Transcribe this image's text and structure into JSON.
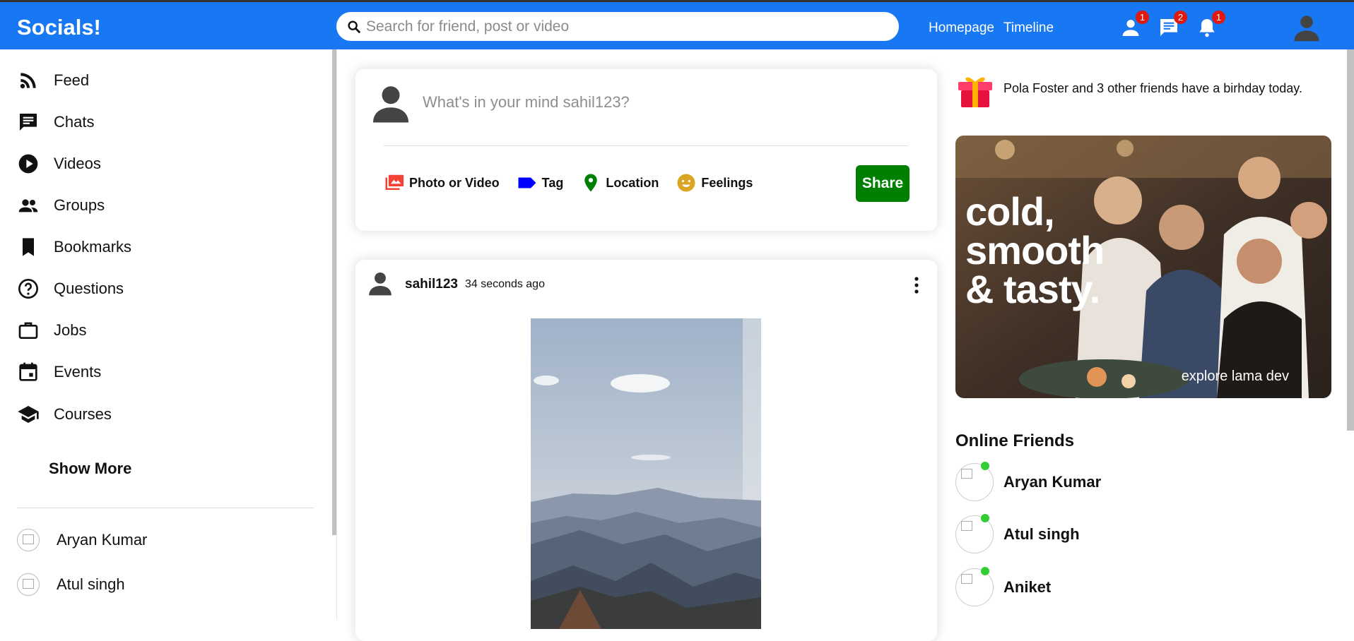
{
  "app": {
    "title": "Socials!"
  },
  "header": {
    "search_placeholder": "Search for friend, post or video",
    "links": [
      "Homepage",
      "Timeline"
    ],
    "badges": {
      "friends": "1",
      "messages": "2",
      "notifications": "1"
    },
    "accent": "#1877f2"
  },
  "sidebar": {
    "items": [
      {
        "label": "Feed",
        "icon": "rss-feed-icon"
      },
      {
        "label": "Chats",
        "icon": "chat-icon"
      },
      {
        "label": "Videos",
        "icon": "play-circle-icon"
      },
      {
        "label": "Groups",
        "icon": "group-icon"
      },
      {
        "label": "Bookmarks",
        "icon": "bookmark-icon"
      },
      {
        "label": "Questions",
        "icon": "help-outline-icon"
      },
      {
        "label": "Jobs",
        "icon": "work-outline-icon"
      },
      {
        "label": "Events",
        "icon": "event-icon"
      },
      {
        "label": "Courses",
        "icon": "school-icon"
      }
    ],
    "show_more": "Show More",
    "friends": [
      "Aryan Kumar",
      "Atul singh"
    ]
  },
  "share": {
    "prompt": "What's in your mind sahil123?",
    "options": [
      {
        "label": "Photo or Video",
        "icon": "perm-media-icon",
        "color": "#f44336"
      },
      {
        "label": "Tag",
        "icon": "label-icon",
        "color": "#0000ff"
      },
      {
        "label": "Location",
        "icon": "room-icon",
        "color": "#008000"
      },
      {
        "label": "Feelings",
        "icon": "emoji-emotions-icon",
        "color": "#daa520"
      }
    ],
    "button": "Share",
    "button_color": "#008000"
  },
  "post": {
    "username": "sahil123",
    "time": "34 seconds ago"
  },
  "rightbar": {
    "birthday": {
      "name": "Pola Foster",
      "mid": " and ",
      "others": "3 other friends",
      "tail": " have a birhday today."
    },
    "ad": {
      "headline_1": "cold,",
      "headline_2": "smooth",
      "headline_3": "& tasty.",
      "tagline": "explore lama dev"
    },
    "online_title": "Online Friends",
    "online": [
      "Aryan Kumar",
      "Atul singh",
      "Aniket"
    ],
    "online_color": "#32cd32"
  }
}
